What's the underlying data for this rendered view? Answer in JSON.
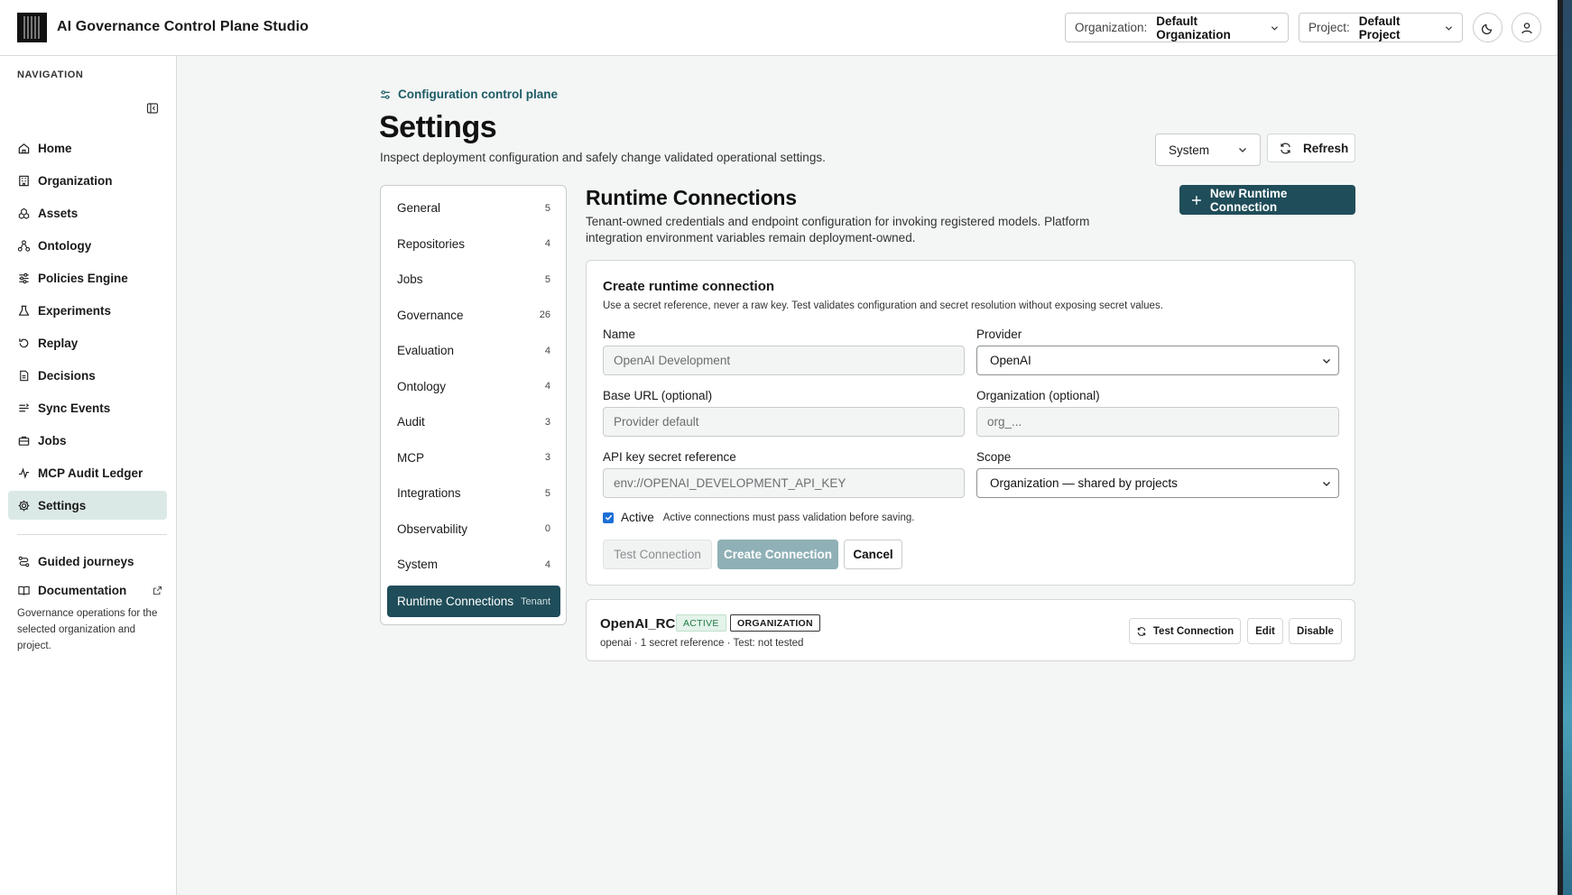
{
  "header": {
    "app_title": "AI Governance Control Plane Studio",
    "org_label": "Organization:",
    "org_value": "Default Organization",
    "project_label": "Project:",
    "project_value": "Default Project"
  },
  "sidebar": {
    "nav_title": "NAVIGATION",
    "items": [
      {
        "label": "Home",
        "icon": "home-icon"
      },
      {
        "label": "Organization",
        "icon": "building-icon"
      },
      {
        "label": "Assets",
        "icon": "assets-icon"
      },
      {
        "label": "Ontology",
        "icon": "ontology-icon"
      },
      {
        "label": "Policies Engine",
        "icon": "sliders-icon"
      },
      {
        "label": "Experiments",
        "icon": "flask-icon"
      },
      {
        "label": "Replay",
        "icon": "replay-icon"
      },
      {
        "label": "Decisions",
        "icon": "document-icon"
      },
      {
        "label": "Sync Events",
        "icon": "sync-events-icon"
      },
      {
        "label": "Jobs",
        "icon": "briefcase-icon"
      },
      {
        "label": "MCP Audit Ledger",
        "icon": "activity-icon"
      },
      {
        "label": "Settings",
        "icon": "gear-icon"
      }
    ],
    "active_item": "Settings",
    "footer_items": [
      {
        "label": "Guided journeys",
        "icon": "route-icon"
      },
      {
        "label": "Documentation",
        "icon": "book-icon"
      }
    ],
    "note": "Governance operations for the selected organization and project."
  },
  "page": {
    "eyebrow": "Configuration control plane",
    "title": "Settings",
    "subtitle": "Inspect deployment configuration and safely change validated operational settings.",
    "scope_select": "System",
    "refresh_label": "Refresh"
  },
  "settings_nav": [
    {
      "label": "General",
      "count": "5"
    },
    {
      "label": "Repositories",
      "count": "4"
    },
    {
      "label": "Jobs",
      "count": "5"
    },
    {
      "label": "Governance",
      "count": "26"
    },
    {
      "label": "Evaluation",
      "count": "4"
    },
    {
      "label": "Ontology",
      "count": "4"
    },
    {
      "label": "Audit",
      "count": "3"
    },
    {
      "label": "MCP",
      "count": "3"
    },
    {
      "label": "Integrations",
      "count": "5"
    },
    {
      "label": "Observability",
      "count": "0"
    },
    {
      "label": "System",
      "count": "4"
    },
    {
      "label": "Runtime Connections",
      "count": "Tenant"
    }
  ],
  "runtime": {
    "title": "Runtime Connections",
    "description": "Tenant-owned credentials and endpoint configuration for invoking registered models. Platform integration environment variables remain deployment-owned.",
    "new_button": "New Runtime Connection",
    "form": {
      "title": "Create runtime connection",
      "help": "Use a secret reference, never a raw key. Test validates configuration and secret resolution without exposing secret values.",
      "name_label": "Name",
      "name_placeholder": "OpenAI Development",
      "provider_label": "Provider",
      "provider_value": "OpenAI",
      "base_url_label": "Base URL (optional)",
      "base_url_placeholder": "Provider default",
      "org_label": "Organization (optional)",
      "org_placeholder": "org_...",
      "api_key_label": "API key secret reference",
      "api_key_placeholder": "env://OPENAI_DEVELOPMENT_API_KEY",
      "scope_label": "Scope",
      "scope_value": "Organization — shared by projects",
      "active_label": "Active",
      "active_checked": true,
      "active_note": "Active connections must pass validation before saving.",
      "test_button": "Test Connection",
      "create_button": "Create Connection",
      "cancel_button": "Cancel"
    },
    "connections": [
      {
        "name": "OpenAI_RC",
        "status_badge": "ACTIVE",
        "scope_badge": "ORGANIZATION",
        "meta": "openai · 1 secret reference · Test: not tested",
        "test_button": "Test Connection",
        "edit_button": "Edit",
        "disable_button": "Disable"
      }
    ]
  },
  "colors": {
    "accent": "#1f4d59",
    "accent_light": "#dbe9e6",
    "active_green": "#1f7a45"
  }
}
